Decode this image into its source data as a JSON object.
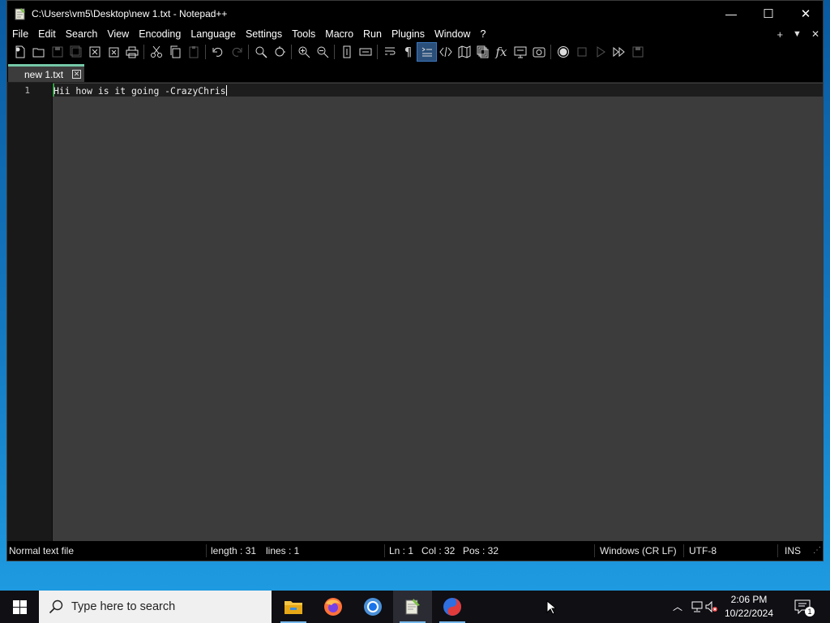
{
  "window": {
    "title": "C:\\Users\\vm5\\Desktop\\new 1.txt - Notepad++",
    "minimize": "—",
    "maximize": "☐",
    "close": "✕"
  },
  "menu": {
    "items": [
      "File",
      "Edit",
      "Search",
      "View",
      "Encoding",
      "Language",
      "Settings",
      "Tools",
      "Macro",
      "Run",
      "Plugins",
      "Window",
      "?"
    ],
    "right": {
      "plus": "+",
      "dropdown": "▼",
      "close": "✕"
    }
  },
  "tab": {
    "label": "new 1.txt",
    "close": "✕"
  },
  "editor": {
    "line_number": "1",
    "text": "Hii how is it going -CrazyChris"
  },
  "status": {
    "file_type": "Normal text file",
    "length": "length : 31",
    "lines": "lines : 1",
    "ln": "Ln : 1",
    "col": "Col : 32",
    "pos": "Pos : 32",
    "eol": "Windows (CR LF)",
    "encoding": "UTF-8",
    "mode": "INS"
  },
  "taskbar": {
    "search_placeholder": "Type here to search",
    "time": "2:06 PM",
    "date": "10/22/2024",
    "notifications": "1"
  },
  "colors": {
    "accent_tab": "#75c9a8",
    "current_line_marker": "#2e9e3f",
    "taskbar_underline": "#76b9ed"
  }
}
